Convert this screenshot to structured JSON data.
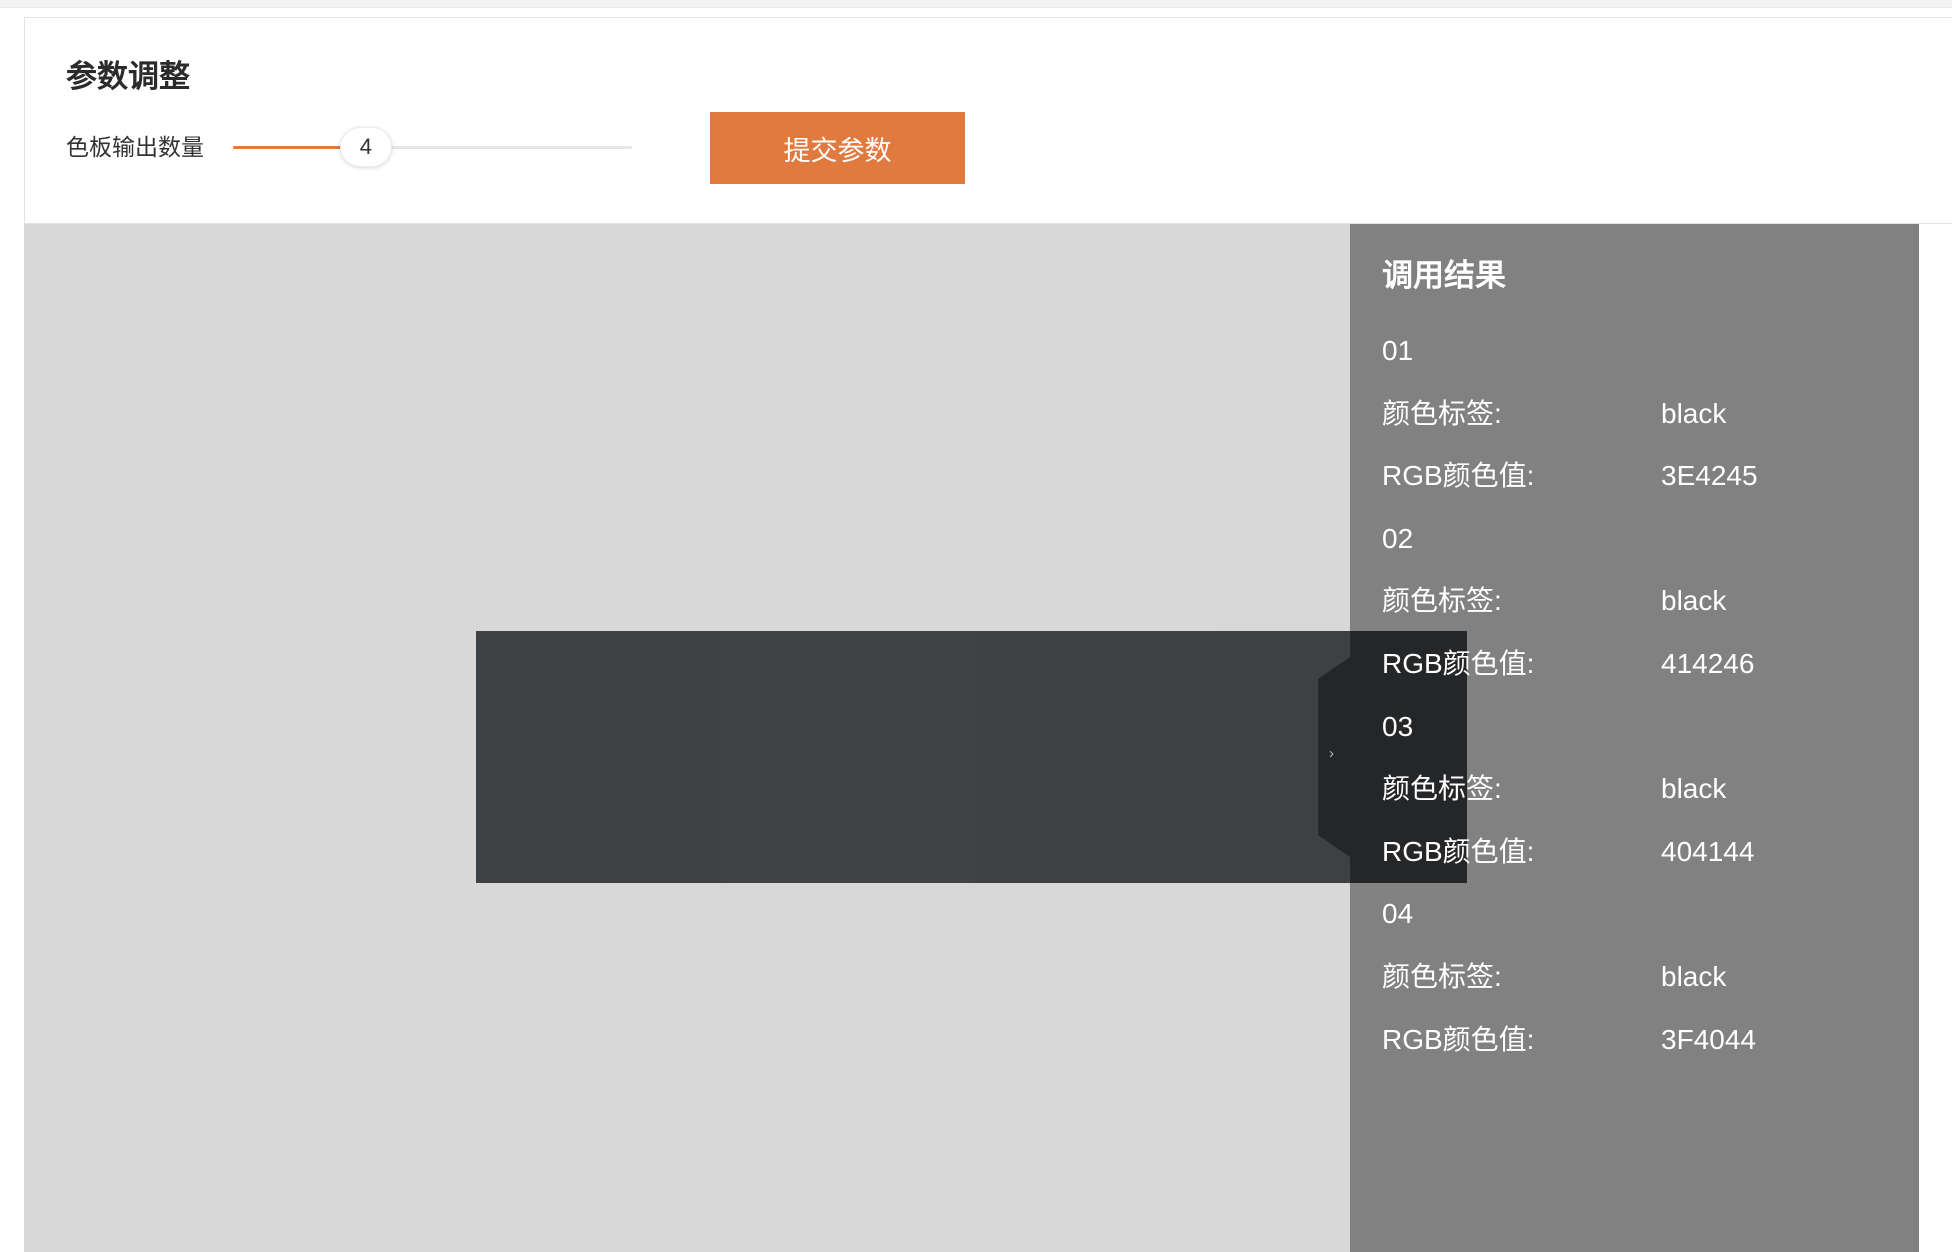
{
  "params": {
    "title": "参数调整",
    "count_label": "色板输出数量",
    "slider": {
      "value_text": "4",
      "fill_fraction": 0.333
    },
    "submit_label": "提交参数"
  },
  "colors": {
    "accent": "#E07A3F",
    "canvas": "#D8D8D8"
  },
  "results": {
    "title": "调用结果",
    "toggle_icon": "chevron-right-icon",
    "items": [
      {
        "index": "01",
        "label_key": "颜色标签:",
        "label_value": "black",
        "rgb_key": "RGB颜色值:",
        "rgb_value": "3E4245"
      },
      {
        "index": "02",
        "label_key": "颜色标签:",
        "label_value": "black",
        "rgb_key": "RGB颜色值:",
        "rgb_value": "414246"
      },
      {
        "index": "03",
        "label_key": "颜色标签:",
        "label_value": "black",
        "rgb_key": "RGB颜色值:",
        "rgb_value": "404144"
      },
      {
        "index": "04",
        "label_key": "颜色标签:",
        "label_value": "black",
        "rgb_key": "RGB颜色值:",
        "rgb_value": "3F4044"
      }
    ]
  }
}
